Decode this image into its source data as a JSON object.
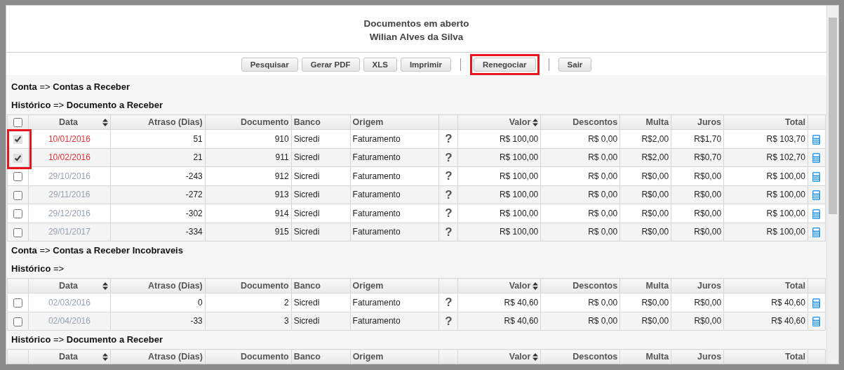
{
  "window": {
    "title": "Documentos em aberto",
    "subtitle": "Wilian Alves da Silva"
  },
  "toolbar": [
    {
      "kind": "button",
      "label": "Pesquisar",
      "highlighted": false
    },
    {
      "kind": "button",
      "label": "Gerar PDF",
      "highlighted": false
    },
    {
      "kind": "button",
      "label": "XLS",
      "highlighted": false
    },
    {
      "kind": "button",
      "label": "Imprimir",
      "highlighted": false
    },
    {
      "kind": "separator"
    },
    {
      "kind": "button",
      "label": "Renegociar",
      "highlighted": true
    },
    {
      "kind": "separator"
    },
    {
      "kind": "button",
      "label": "Sair",
      "highlighted": false
    }
  ],
  "blocks": [
    {
      "kind": "heading",
      "text": "**Conta** => **Contas a Receber**"
    },
    {
      "kind": "heading",
      "text": "**Histórico** => **Documento a Receber**"
    },
    {
      "kind": "table",
      "select_all": {
        "checked": false
      },
      "columns": [
        {
          "kind": "check"
        },
        {
          "kind": "text",
          "label": "Data",
          "sortable": true
        },
        {
          "kind": "text",
          "label": "Atraso (Dias)",
          "sortable": false
        },
        {
          "kind": "text",
          "label": "Documento",
          "sortable": false
        },
        {
          "kind": "text",
          "label": "Banco",
          "sortable": false
        },
        {
          "kind": "text",
          "label": "Origem",
          "sortable": false
        },
        {
          "kind": "help"
        },
        {
          "kind": "text",
          "label": "Valor",
          "sortable": true
        },
        {
          "kind": "text",
          "label": "Descontos",
          "sortable": false
        },
        {
          "kind": "text",
          "label": "Multa",
          "sortable": false
        },
        {
          "kind": "text",
          "label": "Juros",
          "sortable": false
        },
        {
          "kind": "text",
          "label": "Total",
          "sortable": false
        },
        {
          "kind": "action"
        }
      ],
      "rows": [
        {
          "checked": true,
          "highlighted": true,
          "overdue": true,
          "cells": [
            "",
            "10/01/2016",
            "51",
            "910",
            "Sicredi",
            "Faturamento",
            "?",
            "R$ 100,00",
            "R$ 0,00",
            "R$2,00",
            "R$1,70",
            "R$ 103,70",
            ""
          ]
        },
        {
          "checked": true,
          "highlighted": true,
          "overdue": true,
          "cells": [
            "",
            "10/02/2016",
            "21",
            "911",
            "Sicredi",
            "Faturamento",
            "?",
            "R$ 100,00",
            "R$ 0,00",
            "R$2,00",
            "R$0,70",
            "R$ 102,70",
            ""
          ]
        },
        {
          "checked": false,
          "highlighted": false,
          "overdue": false,
          "cells": [
            "",
            "29/10/2016",
            "-243",
            "912",
            "Sicredi",
            "Faturamento",
            "?",
            "R$ 100,00",
            "R$ 0,00",
            "R$0,00",
            "R$0,00",
            "R$ 100,00",
            ""
          ]
        },
        {
          "checked": false,
          "highlighted": false,
          "overdue": false,
          "cells": [
            "",
            "29/11/2016",
            "-272",
            "913",
            "Sicredi",
            "Faturamento",
            "?",
            "R$ 100,00",
            "R$ 0,00",
            "R$0,00",
            "R$0,00",
            "R$ 100,00",
            ""
          ]
        },
        {
          "checked": false,
          "highlighted": false,
          "overdue": false,
          "cells": [
            "",
            "29/12/2016",
            "-302",
            "914",
            "Sicredi",
            "Faturamento",
            "?",
            "R$ 100,00",
            "R$ 0,00",
            "R$0,00",
            "R$0,00",
            "R$ 100,00",
            ""
          ]
        },
        {
          "checked": false,
          "highlighted": false,
          "overdue": false,
          "cells": [
            "",
            "29/01/2017",
            "-334",
            "915",
            "Sicredi",
            "Faturamento",
            "?",
            "R$ 100,00",
            "R$ 0,00",
            "R$0,00",
            "R$0,00",
            "R$ 100,00",
            ""
          ]
        }
      ]
    },
    {
      "kind": "heading",
      "text": "**Conta** => **Contas a Receber Incobraveis**"
    },
    {
      "kind": "heading",
      "text": "**Histórico** =>"
    },
    {
      "kind": "table",
      "columns": [
        {
          "kind": "check"
        },
        {
          "kind": "text",
          "label": "Data",
          "sortable": true
        },
        {
          "kind": "text",
          "label": "Atraso (Dias)",
          "sortable": false
        },
        {
          "kind": "text",
          "label": "Documento",
          "sortable": false
        },
        {
          "kind": "text",
          "label": "Banco",
          "sortable": false
        },
        {
          "kind": "text",
          "label": "Origem",
          "sortable": false
        },
        {
          "kind": "help"
        },
        {
          "kind": "text",
          "label": "Valor",
          "sortable": true
        },
        {
          "kind": "text",
          "label": "Descontos",
          "sortable": false
        },
        {
          "kind": "text",
          "label": "Multa",
          "sortable": false
        },
        {
          "kind": "text",
          "label": "Juros",
          "sortable": false
        },
        {
          "kind": "text",
          "label": "Total",
          "sortable": false
        },
        {
          "kind": "action"
        }
      ],
      "rows": [
        {
          "checked": false,
          "highlighted": false,
          "overdue": false,
          "cells": [
            "",
            "02/03/2016",
            "0",
            "2",
            "Sicredi",
            "Faturamento",
            "?",
            "R$ 40,60",
            "R$ 0,00",
            "R$0,00",
            "R$0,00",
            "R$ 40,60",
            ""
          ]
        },
        {
          "checked": false,
          "highlighted": false,
          "overdue": false,
          "cells": [
            "",
            "02/04/2016",
            "-33",
            "3",
            "Sicredi",
            "Faturamento",
            "?",
            "R$ 40,60",
            "R$ 0,00",
            "R$0,00",
            "R$0,00",
            "R$ 40,60",
            ""
          ]
        }
      ]
    },
    {
      "kind": "heading",
      "text": "**Histórico** => **Documento a Receber**"
    },
    {
      "kind": "table",
      "columns": [
        {
          "kind": "check"
        },
        {
          "kind": "text",
          "label": "Data",
          "sortable": true
        },
        {
          "kind": "text",
          "label": "Atraso (Dias)",
          "sortable": false
        },
        {
          "kind": "text",
          "label": "Documento",
          "sortable": false
        },
        {
          "kind": "text",
          "label": "Banco",
          "sortable": false
        },
        {
          "kind": "text",
          "label": "Origem",
          "sortable": false
        },
        {
          "kind": "help"
        },
        {
          "kind": "text",
          "label": "Valor",
          "sortable": true
        },
        {
          "kind": "text",
          "label": "Descontos",
          "sortable": false
        },
        {
          "kind": "text",
          "label": "Multa",
          "sortable": false
        },
        {
          "kind": "text",
          "label": "Juros",
          "sortable": false
        },
        {
          "kind": "text",
          "label": "Total",
          "sortable": false
        },
        {
          "kind": "action"
        }
      ]
    }
  ]
}
